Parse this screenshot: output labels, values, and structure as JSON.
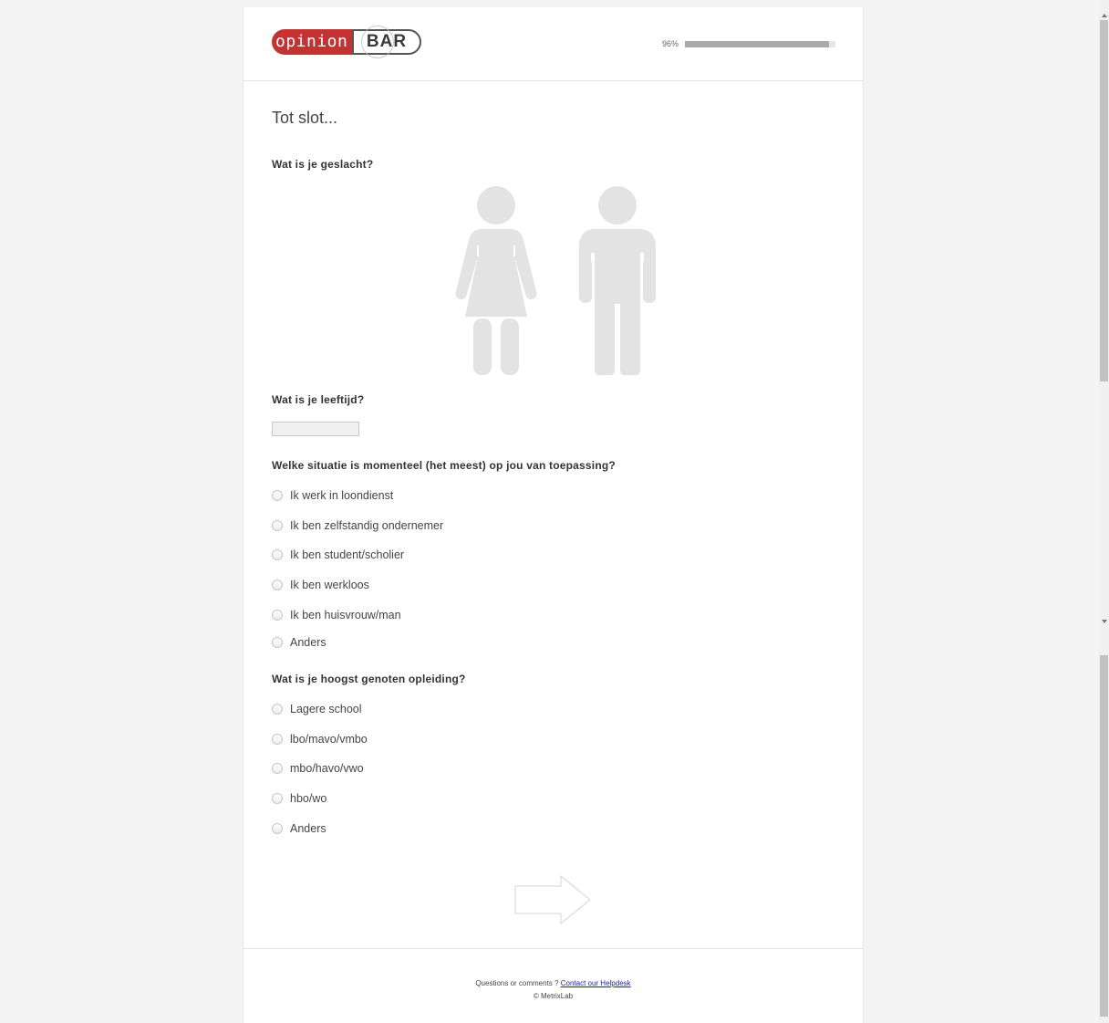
{
  "header": {
    "logo_text_left": "opinion",
    "logo_text_right": "BAR",
    "progress_text": "96%",
    "progress_value": 0.96
  },
  "survey": {
    "title": "Tot slot...",
    "q_gender": "Wat is je geslacht?",
    "gender_options": [
      "female-figure",
      "male-figure"
    ],
    "q_age": "Wat is je leeftijd?",
    "age_value": "",
    "q_situation": "Welke situatie is momenteel (het meest) op jou van toepassing?",
    "situation_options": [
      "Ik werk in loondienst",
      "Ik ben zelfstandig ondernemer",
      "Ik ben student/scholier",
      "Ik ben werkloos",
      "Ik ben huisvrouw/man",
      "Anders"
    ],
    "q_education": "Wat is je hoogst genoten opleiding?",
    "education_options": [
      "Lagere school",
      "lbo/mavo/vmbo",
      "mbo/havo/vwo",
      "hbo/wo",
      "Anders"
    ]
  },
  "footer": {
    "question_text": "Questions or comments ?",
    "helpdesk_link": "Contact our Helpdesk",
    "copyright": "© MetrixLab"
  },
  "colors": {
    "brand_red": "#c43334",
    "figure_grey": "#e3e3e3"
  }
}
